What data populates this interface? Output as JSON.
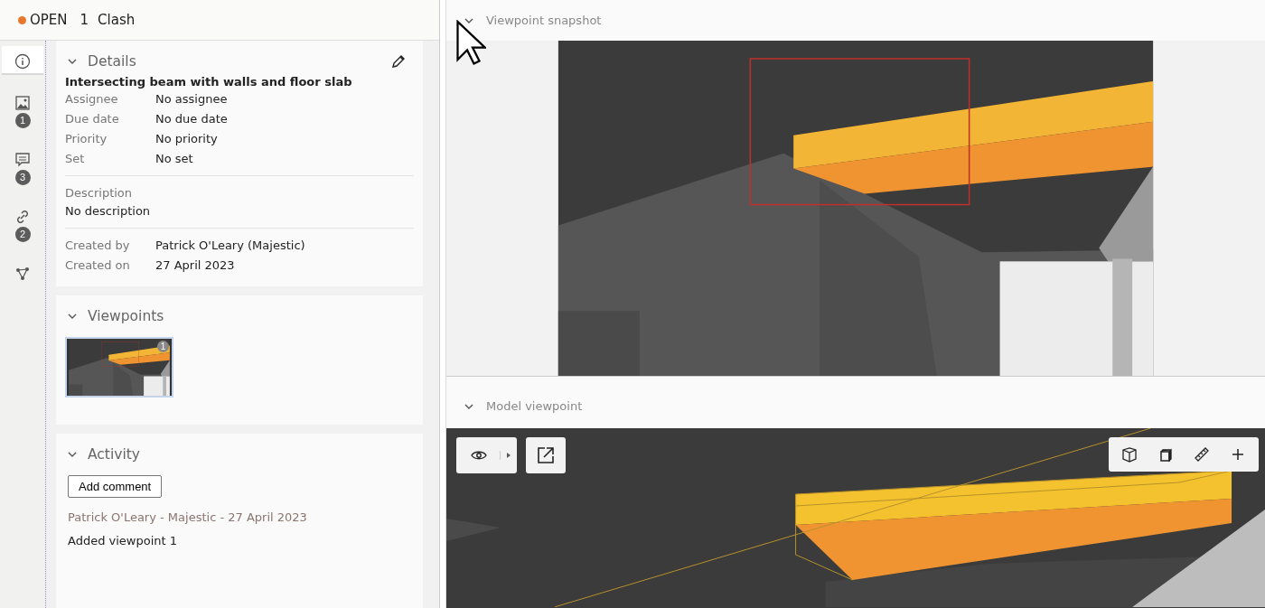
{
  "header": {
    "status": "OPEN",
    "number": "1",
    "title": "Clash"
  },
  "rail": [
    {
      "kind": "info",
      "selected": true
    },
    {
      "kind": "image",
      "badge": "1",
      "selected": false
    },
    {
      "kind": "comment",
      "badge": "3",
      "selected": false
    },
    {
      "kind": "link",
      "badge": "2",
      "selected": false
    },
    {
      "kind": "graph",
      "selected": false
    }
  ],
  "details": {
    "title": "Details",
    "expanded": true,
    "issue_title": "Intersecting beam with walls and floor slab",
    "fields": [
      {
        "label": "Assignee",
        "value": "No assignee"
      },
      {
        "label": "Due date",
        "value": "No due date"
      },
      {
        "label": "Priority",
        "value": "No priority"
      },
      {
        "label": "Set",
        "value": "No set"
      }
    ],
    "description_label": "Description",
    "description": "No description",
    "meta": [
      {
        "label": "Created by",
        "value": "Patrick O'Leary (Majestic)"
      },
      {
        "label": "Created on",
        "value": "27 April 2023"
      }
    ]
  },
  "viewpoints": {
    "title": "Viewpoints",
    "expanded": true,
    "items": [
      {
        "badge": "1",
        "selected": true
      }
    ]
  },
  "activity": {
    "title": "Activity",
    "expanded": true,
    "button": "Add comment",
    "entries": [
      {
        "byline": "Patrick O'Leary - Majestic - 27 April 2023",
        "text": "Added viewpoint 1"
      }
    ]
  },
  "snapshot": {
    "title": "Viewpoint snapshot",
    "expanded": true
  },
  "model": {
    "title": "Model viewpoint",
    "expanded": true
  }
}
